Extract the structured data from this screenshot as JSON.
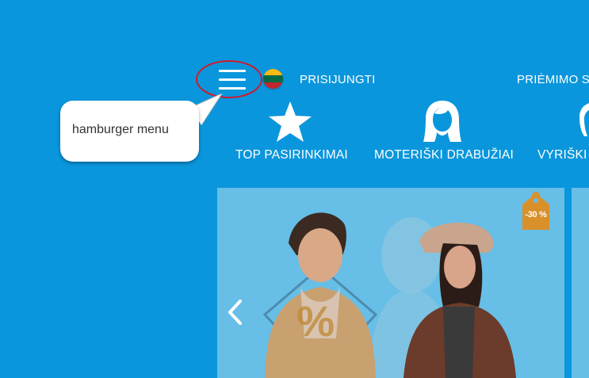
{
  "header": {
    "login_label": "PRISIJUNGTI",
    "acceptance_label": "PRIĖMIMO S",
    "language_flag": "lithuania-flag",
    "flag_colors": [
      "#fdb913",
      "#006a44",
      "#c1272d"
    ]
  },
  "annotation": {
    "callout_text": "hamburger menu",
    "highlight_color": "#d0192b"
  },
  "nav": {
    "items": [
      {
        "label": "TOP PASIRINKIMAI",
        "icon": "star-icon"
      },
      {
        "label": "MOTERIŠKI DRABUŽIAI",
        "icon": "woman-head-icon"
      },
      {
        "label": "VYRIŠKI D",
        "icon": "man-head-icon"
      }
    ]
  },
  "banner": {
    "discount_tag": "-30 %",
    "tag_color": "#d9902b",
    "percent_symbol": "%"
  },
  "colors": {
    "background": "#0a96dc",
    "banner_overlay": "#67bee6"
  }
}
